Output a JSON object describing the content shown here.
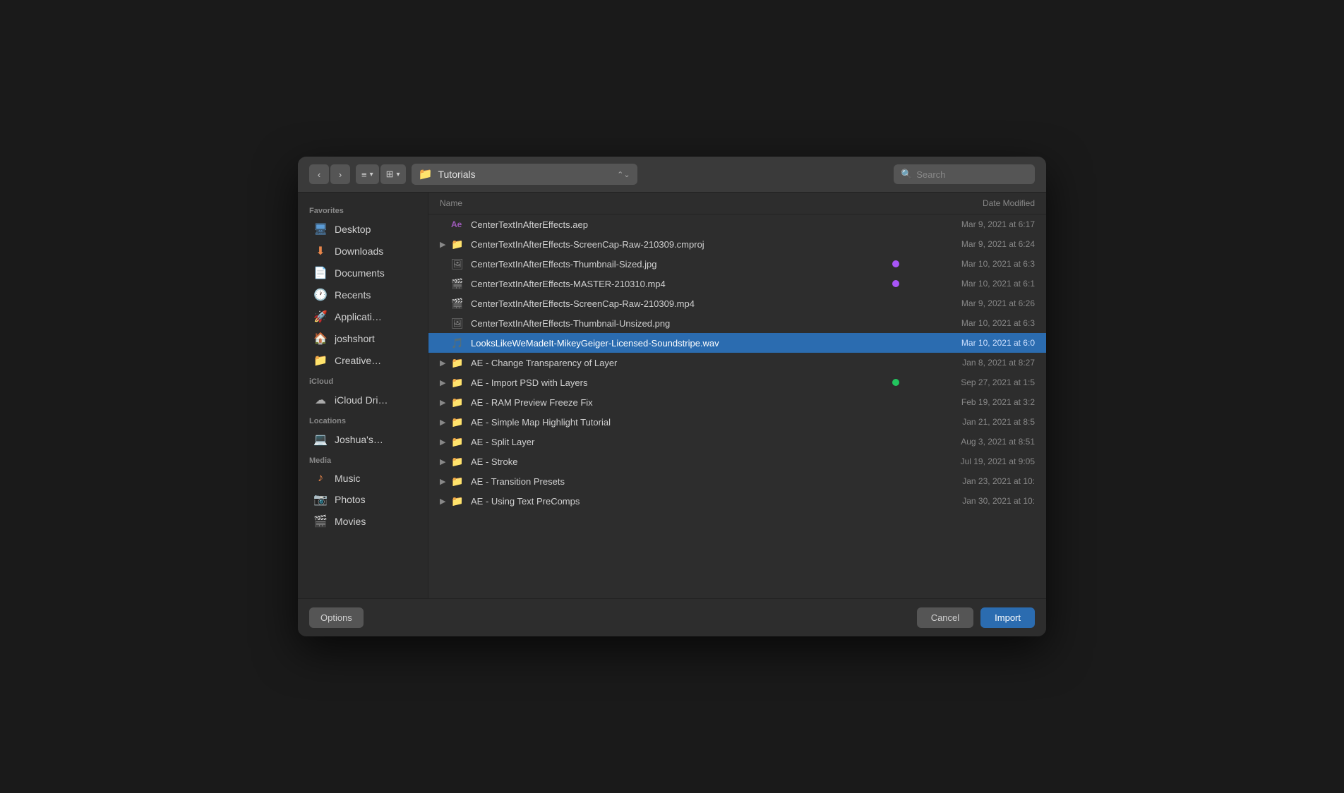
{
  "toolbar": {
    "back_label": "‹",
    "forward_label": "›",
    "list_view_label": "≡",
    "grid_view_label": "⊞",
    "location": "Tutorials",
    "search_placeholder": "Search"
  },
  "sidebar": {
    "favorites_label": "Favorites",
    "icloud_label": "iCloud",
    "locations_label": "Locations",
    "media_label": "Media",
    "items": [
      {
        "id": "desktop",
        "label": "Desktop",
        "icon": "🖥"
      },
      {
        "id": "downloads",
        "label": "Downloads",
        "icon": "⬇"
      },
      {
        "id": "documents",
        "label": "Documents",
        "icon": "📄"
      },
      {
        "id": "recents",
        "label": "Recents",
        "icon": "🕐"
      },
      {
        "id": "applications",
        "label": "Applicati…",
        "icon": "🚀"
      },
      {
        "id": "joshshort",
        "label": "joshshort",
        "icon": "🏠"
      },
      {
        "id": "creative",
        "label": "Creative…",
        "icon": "📁"
      },
      {
        "id": "icloud_drive",
        "label": "iCloud Dri…",
        "icon": "☁"
      },
      {
        "id": "joshua_mac",
        "label": "Joshua's…",
        "icon": "💻"
      },
      {
        "id": "music",
        "label": "Music",
        "icon": "♪"
      },
      {
        "id": "photos",
        "label": "Photos",
        "icon": "📷"
      },
      {
        "id": "movies",
        "label": "Movies",
        "icon": "🎬"
      }
    ]
  },
  "file_list": {
    "col_name": "Name",
    "col_date": "Date Modified",
    "files": [
      {
        "id": 1,
        "name": "CenterTextInAfterEffects.aep",
        "date": "Mar 9, 2021 at 6:17",
        "icon": "Ae",
        "type": "file",
        "dot": null,
        "expanded": false
      },
      {
        "id": 2,
        "name": "CenterTextInAfterEffects-ScreenCap-Raw-210309.cmproj",
        "date": "Mar 9, 2021 at 6:24",
        "icon": "📁",
        "type": "folder",
        "dot": null,
        "expanded": false
      },
      {
        "id": 3,
        "name": "CenterTextInAfterEffects-Thumbnail-Sized.jpg",
        "date": "Mar 10, 2021 at 6:3",
        "icon": "🖼",
        "type": "file",
        "dot": "purple",
        "expanded": false
      },
      {
        "id": 4,
        "name": "CenterTextInAfterEffects-MASTER-210310.mp4",
        "date": "Mar 10, 2021 at 6:1",
        "icon": "🎬",
        "type": "file",
        "dot": "purple",
        "expanded": false
      },
      {
        "id": 5,
        "name": "CenterTextInAfterEffects-ScreenCap-Raw-210309.mp4",
        "date": "Mar 9, 2021 at 6:26",
        "icon": "🎬",
        "type": "file",
        "dot": null,
        "expanded": false
      },
      {
        "id": 6,
        "name": "CenterTextInAfterEffects-Thumbnail-Unsized.png",
        "date": "Mar 10, 2021 at 6:3",
        "icon": "🖼",
        "type": "file",
        "dot": null,
        "expanded": false
      },
      {
        "id": 7,
        "name": "LooksLikeWeMadeIt-MikeyGeiger-Licensed-Soundstripe.wav",
        "date": "Mar 10, 2021 at 6:0",
        "icon": "🎵",
        "type": "file",
        "dot": null,
        "selected": true,
        "expanded": false
      },
      {
        "id": 8,
        "name": "AE - Change Transparency of Layer",
        "date": "Jan 8, 2021 at 8:27",
        "icon": "📁",
        "type": "folder",
        "dot": null,
        "expanded": false
      },
      {
        "id": 9,
        "name": "AE - Import PSD with Layers",
        "date": "Sep 27, 2021 at 1:5",
        "icon": "📁",
        "type": "folder",
        "dot": "green",
        "expanded": false
      },
      {
        "id": 10,
        "name": "AE - RAM Preview Freeze Fix",
        "date": "Feb 19, 2021 at 3:2",
        "icon": "📁",
        "type": "folder",
        "dot": null,
        "expanded": false
      },
      {
        "id": 11,
        "name": "AE - Simple Map Highlight Tutorial",
        "date": "Jan 21, 2021 at 8:5",
        "icon": "📁",
        "type": "folder",
        "dot": null,
        "expanded": false
      },
      {
        "id": 12,
        "name": "AE - Split Layer",
        "date": "Aug 3, 2021 at 8:51",
        "icon": "📁",
        "type": "folder",
        "dot": null,
        "expanded": false
      },
      {
        "id": 13,
        "name": "AE - Stroke",
        "date": "Jul 19, 2021 at 9:05",
        "icon": "📁",
        "type": "folder",
        "dot": null,
        "expanded": false
      },
      {
        "id": 14,
        "name": "AE - Transition Presets",
        "date": "Jan 23, 2021 at 10:",
        "icon": "📁",
        "type": "folder",
        "dot": null,
        "expanded": false
      },
      {
        "id": 15,
        "name": "AE - Using Text PreComps",
        "date": "Jan 30, 2021 at 10:",
        "icon": "📁",
        "type": "folder",
        "dot": null,
        "expanded": false
      }
    ]
  },
  "footer": {
    "options_label": "Options",
    "cancel_label": "Cancel",
    "import_label": "Import"
  }
}
